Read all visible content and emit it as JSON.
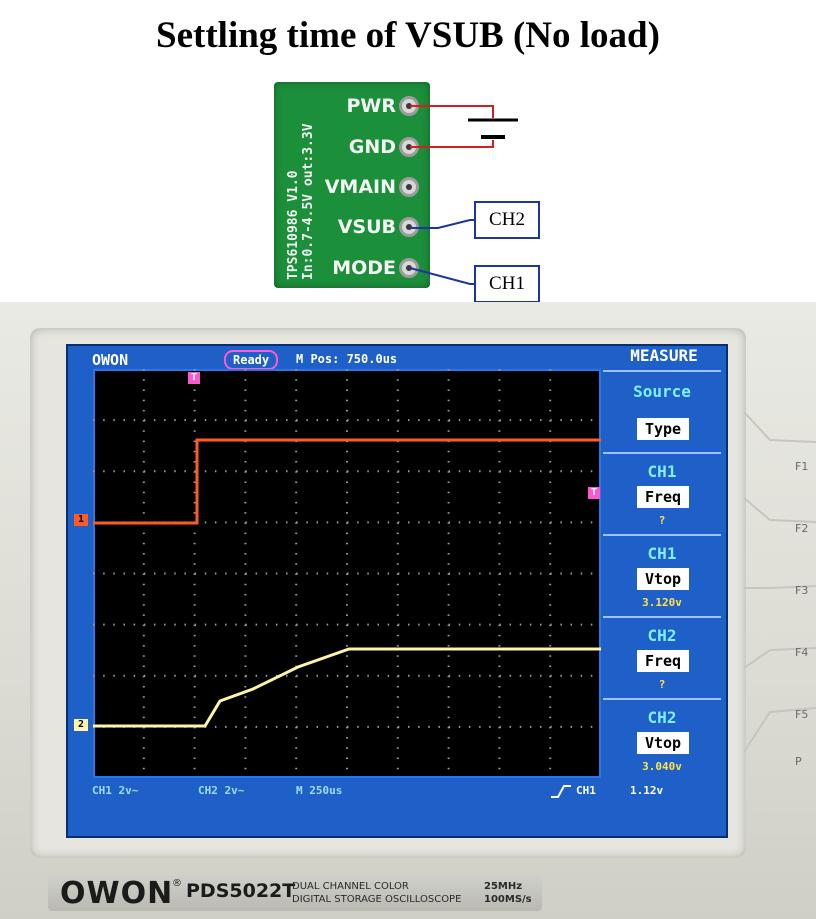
{
  "title": "Settling time of VSUB (No load)",
  "board": {
    "side_text_line1": "TPS610986 V1.0",
    "side_text_line2": "In:0.7-4.5V out:3.3V",
    "pins": [
      "PWR",
      "GND",
      "VMAIN",
      "VSUB",
      "MODE"
    ],
    "probe_labels": {
      "ch2": "CH2",
      "ch1": "CH1"
    },
    "wire_color": "#d22020",
    "probe_wire_color": "#1c35a0"
  },
  "scope": {
    "logo": "OWON",
    "status": "Ready",
    "mpos": "M Pos: 750.0us",
    "menu_title": "MEASURE",
    "menu": [
      {
        "head": "Source",
        "box": "Type",
        "value": ""
      },
      {
        "head": "CH1",
        "box": "Freq",
        "value": "?"
      },
      {
        "head": "CH1",
        "box": "Vtop",
        "value": "3.120v"
      },
      {
        "head": "CH2",
        "box": "Freq",
        "value": "?"
      },
      {
        "head": "CH2",
        "box": "Vtop",
        "value": "3.040v"
      }
    ],
    "footer": {
      "ch1": "CH1  2v~",
      "ch2": "CH2  2v~",
      "timebase": "M 250us",
      "trig_source": "CH1",
      "trig_level": "1.12v"
    },
    "markers": {
      "trigger_top": "T",
      "ch1": "1",
      "ch2": "2",
      "trigger_level": "T"
    },
    "fkeys": [
      "F1",
      "F2",
      "F3",
      "F4",
      "F5",
      "P"
    ],
    "colors": {
      "ch1": "#ff5a2a",
      "ch2": "#fff4a8",
      "screen": "#1f60c8",
      "plot_bg": "#000000"
    }
  },
  "brand": {
    "logo": "OWON",
    "registered": "®",
    "model": "PDS5022T",
    "desc_line1": "DUAL CHANNEL COLOR",
    "desc_line2": "DIGITAL STORAGE OSCILLOSCOPE",
    "spec_line1": "25MHz",
    "spec_line2": "100MS/s"
  }
}
